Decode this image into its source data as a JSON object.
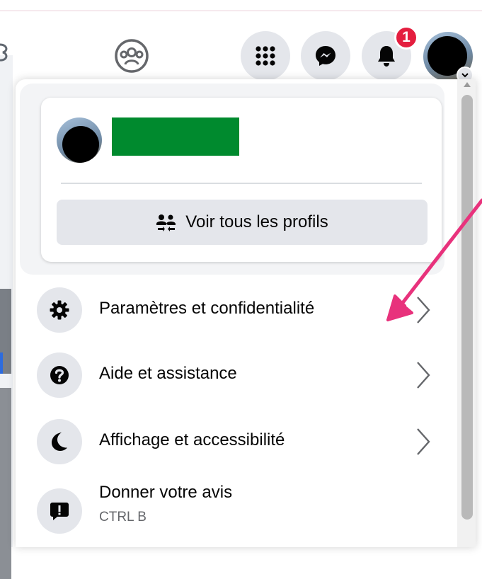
{
  "header": {
    "notification_count": "1",
    "icons": [
      "groups-icon",
      "menu-grid-icon",
      "messenger-icon",
      "bell-icon",
      "avatar",
      "chevron-down-icon"
    ]
  },
  "profile": {
    "see_all_profiles_label": "Voir tous les profils"
  },
  "menu": {
    "items": [
      {
        "label": "Paramètres et confidentialité",
        "icon": "gear-icon"
      },
      {
        "label": "Aide et assistance",
        "icon": "question-icon"
      },
      {
        "label": "Affichage et accessibilité",
        "icon": "moon-icon"
      },
      {
        "label": "Donner votre avis",
        "shortcut": "CTRL B",
        "icon": "feedback-icon"
      }
    ]
  },
  "colors": {
    "accent_arrow": "#e8327c",
    "badge": "#e41e3f",
    "redaction": "#008a2e",
    "button_bg": "#e4e6eb"
  }
}
